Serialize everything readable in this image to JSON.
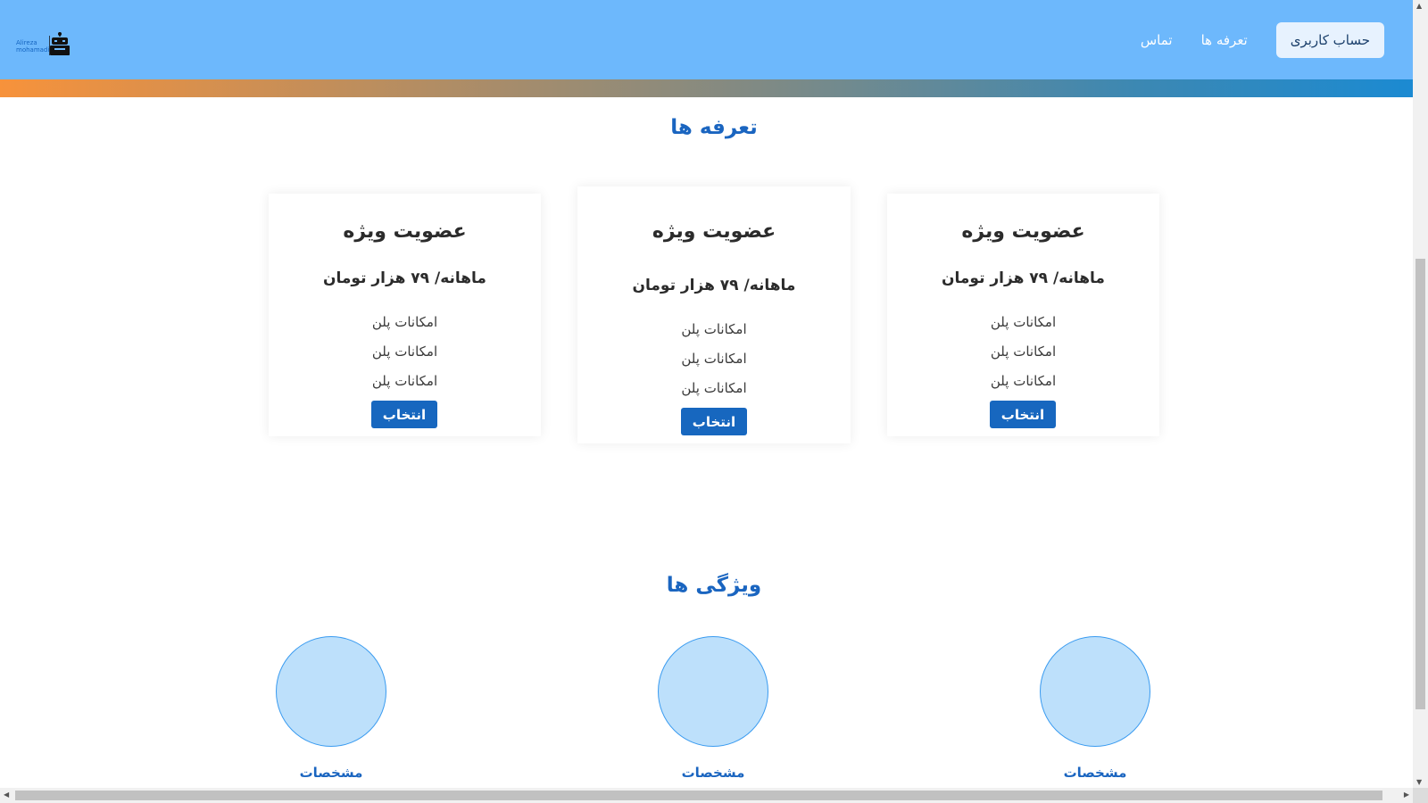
{
  "header": {
    "logo_text_line1": "Alireza",
    "logo_text_line2": "mohamadi",
    "account_button": "حساب کاربری",
    "nav_pricing": "تعرفه ها",
    "nav_contact": "تماس",
    "colors": {
      "background": "#6db8fc",
      "gradient_start": "#f7923b",
      "gradient_end": "#1b8ad2"
    }
  },
  "pricing": {
    "title": "تعرفه ها",
    "cards": [
      {
        "name": "عضویت ویژه",
        "price": "ماهانه/ ۷۹ هزار تومان",
        "features": [
          "امکانات پلن",
          "امکانات پلن",
          "امکانات پلن"
        ],
        "button": "انتخاب"
      },
      {
        "name": "عضویت ویژه",
        "price": "ماهانه/ ۷۹ هزار تومان",
        "features": [
          "امکانات پلن",
          "امکانات پلن",
          "امکانات پلن"
        ],
        "button": "انتخاب"
      },
      {
        "name": "عضویت ویژه",
        "price": "ماهانه/ ۷۹ هزار تومان",
        "features": [
          "امکانات پلن",
          "امکانات پلن",
          "امکانات پلن"
        ],
        "button": "انتخاب"
      }
    ]
  },
  "features": {
    "title": "ویژگی ها",
    "items": [
      {
        "label": "مشخصات"
      },
      {
        "label": "مشخصات"
      },
      {
        "label": "مشخصات"
      }
    ]
  },
  "colors": {
    "accent": "#1767bf",
    "title": "#1a65c0",
    "circle_fill": "#bde0fb",
    "circle_border": "#3a9bf0"
  }
}
